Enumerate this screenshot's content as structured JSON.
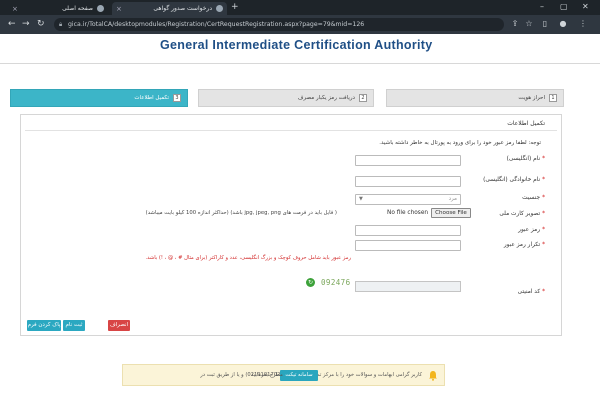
{
  "browser": {
    "tabs": [
      {
        "title": "صفحه اصلی",
        "active": false
      },
      {
        "title": "درخواست صدور گواهی",
        "active": true
      }
    ],
    "new_tab": "+",
    "url": "gica.ir/TotalCA/desktopmodules/Registration/CertRequestRegistration.aspx?page=79&mid=126"
  },
  "header": {
    "title": "General Intermediate Certification Authority"
  },
  "steps": [
    {
      "num": "1",
      "label": "احراز هویت"
    },
    {
      "num": "2",
      "label": "دریافت رمز یکبار مصرف"
    },
    {
      "num": "3",
      "label": "تکمیل اطلاعات"
    }
  ],
  "form": {
    "title": "تکمیل اطلاعات",
    "notice": "توجه: لطفا رمز عبور خود را برای ورود به پورتال به خاطر داشته باشید.",
    "fields": [
      {
        "label": "نام (انگلیسی)",
        "required": true,
        "value": ""
      },
      {
        "label": "نام خانوادگی (انگلیسی)",
        "required": true,
        "value": ""
      },
      {
        "label": "جنسیت",
        "required": true,
        "value": "مرد"
      },
      {
        "label": "تصویر کارت ملی",
        "required": true,
        "value": ""
      },
      {
        "label": "رمز عبور",
        "required": true,
        "value": ""
      },
      {
        "label": "تکرار رمز عبور",
        "required": true,
        "value": ""
      },
      {
        "label": "کد امنیتی",
        "required": true,
        "value": ""
      }
    ],
    "file_button": "Choose File",
    "file_status": "No file chosen",
    "file_hint": "( فایل باید در فرمت های jpg, jpeg, png باشد) (حداکثر اندازه 100 کیلو بایت میباشد)",
    "password_warning": "رمز عبور باید شامل حروف کوچک و بزرگ انگلیسی، عدد و کاراکتر (برای مثال # ، @ ، !) باشد.",
    "captcha": "092476",
    "buttons": {
      "clear": "پاک کردن فرم",
      "submit": "ثبت نام",
      "cancel": "انصراف"
    }
  },
  "footer": {
    "text": "کاربر گرامی ابهامات و سوالات خود را با مرکز تماس به شماره (02191017020) و یا از طریق ثبت در",
    "ticket_button": "سامانه تیکت",
    "text_end": "مطرح بفرمایید"
  }
}
